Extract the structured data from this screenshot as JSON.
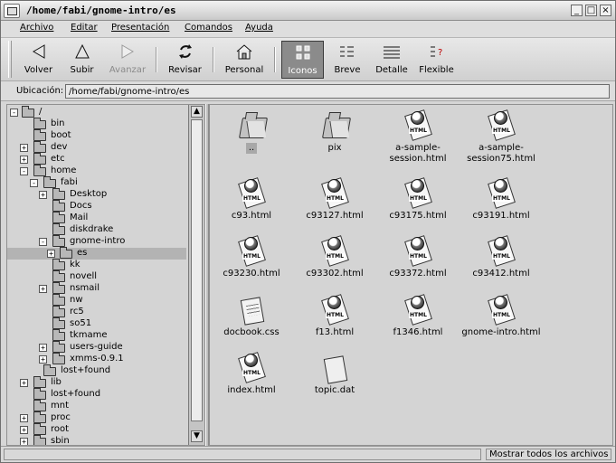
{
  "window": {
    "title": "/home/fabi/gnome-intro/es",
    "controls": [
      "_",
      "□",
      "×"
    ]
  },
  "menubar": [
    "Archivo",
    "Editar",
    "Presentación",
    "Comandos",
    "Ayuda"
  ],
  "toolbar": [
    {
      "label": "Volver",
      "icon": "back-arrow-icon",
      "state": "normal"
    },
    {
      "label": "Subir",
      "icon": "up-arrow-icon",
      "state": "normal"
    },
    {
      "label": "Avanzar",
      "icon": "forward-arrow-icon",
      "state": "disabled"
    },
    {
      "label": "Revisar",
      "icon": "reload-icon",
      "state": "normal"
    },
    {
      "label": "Personal",
      "icon": "home-icon",
      "state": "normal"
    },
    {
      "label": "Iconos",
      "icon": "icons-view-icon",
      "state": "active"
    },
    {
      "label": "Breve",
      "icon": "brief-view-icon",
      "state": "normal"
    },
    {
      "label": "Detalle",
      "icon": "detail-view-icon",
      "state": "normal"
    },
    {
      "label": "Flexible",
      "icon": "flexible-view-icon",
      "state": "normal"
    }
  ],
  "location": {
    "label": "Ubicación:",
    "value": "/home/fabi/gnome-intro/es"
  },
  "tree": {
    "items": [
      {
        "label": "/",
        "expander": "-"
      },
      {
        "label": "bin",
        "expander": ""
      },
      {
        "label": "boot",
        "expander": ""
      },
      {
        "label": "dev",
        "expander": "+"
      },
      {
        "label": "etc",
        "expander": "+"
      },
      {
        "label": "home",
        "expander": "-"
      },
      {
        "label": "fabi",
        "expander": "-"
      },
      {
        "label": "Desktop",
        "expander": "+"
      },
      {
        "label": "Docs",
        "expander": ""
      },
      {
        "label": "Mail",
        "expander": ""
      },
      {
        "label": "diskdrake",
        "expander": ""
      },
      {
        "label": "gnome-intro",
        "expander": "-"
      },
      {
        "label": "es",
        "expander": "+"
      },
      {
        "label": "kk",
        "expander": ""
      },
      {
        "label": "novell",
        "expander": ""
      },
      {
        "label": "nsmail",
        "expander": "+"
      },
      {
        "label": "nw",
        "expander": ""
      },
      {
        "label": "rc5",
        "expander": ""
      },
      {
        "label": "so51",
        "expander": ""
      },
      {
        "label": "tkmame",
        "expander": ""
      },
      {
        "label": "users-guide",
        "expander": "+"
      },
      {
        "label": "xmms-0.9.1",
        "expander": "+"
      },
      {
        "label": "lost+found",
        "expander": ""
      },
      {
        "label": "lib",
        "expander": "+"
      },
      {
        "label": "lost+found",
        "expander": ""
      },
      {
        "label": "mnt",
        "expander": ""
      },
      {
        "label": "proc",
        "expander": "+"
      },
      {
        "label": "root",
        "expander": "+"
      },
      {
        "label": "sbin",
        "expander": "+"
      }
    ]
  },
  "files": [
    {
      "label": "..",
      "icon": "folder-icon"
    },
    {
      "label": "pix",
      "icon": "folder-icon"
    },
    {
      "label": "a-sample-session.html",
      "icon": "html-file-icon"
    },
    {
      "label": "a-sample-session75.html",
      "icon": "html-file-icon"
    },
    {
      "label": "c93.html",
      "icon": "html-file-icon"
    },
    {
      "label": "c93127.html",
      "icon": "html-file-icon"
    },
    {
      "label": "c93175.html",
      "icon": "html-file-icon"
    },
    {
      "label": "c93191.html",
      "icon": "html-file-icon"
    },
    {
      "label": "c93230.html",
      "icon": "html-file-icon"
    },
    {
      "label": "c93302.html",
      "icon": "html-file-icon"
    },
    {
      "label": "c93372.html",
      "icon": "html-file-icon"
    },
    {
      "label": "c93412.html",
      "icon": "html-file-icon"
    },
    {
      "label": "docbook.css",
      "icon": "text-file-icon"
    },
    {
      "label": "f13.html",
      "icon": "html-file-icon"
    },
    {
      "label": "f1346.html",
      "icon": "html-file-icon"
    },
    {
      "label": "gnome-intro.html",
      "icon": "html-file-icon"
    },
    {
      "label": "index.html",
      "icon": "html-file-icon"
    },
    {
      "label": "topic.dat",
      "icon": "blank-file-icon"
    }
  ],
  "status": {
    "message": "Mostrar todos los archivos"
  }
}
